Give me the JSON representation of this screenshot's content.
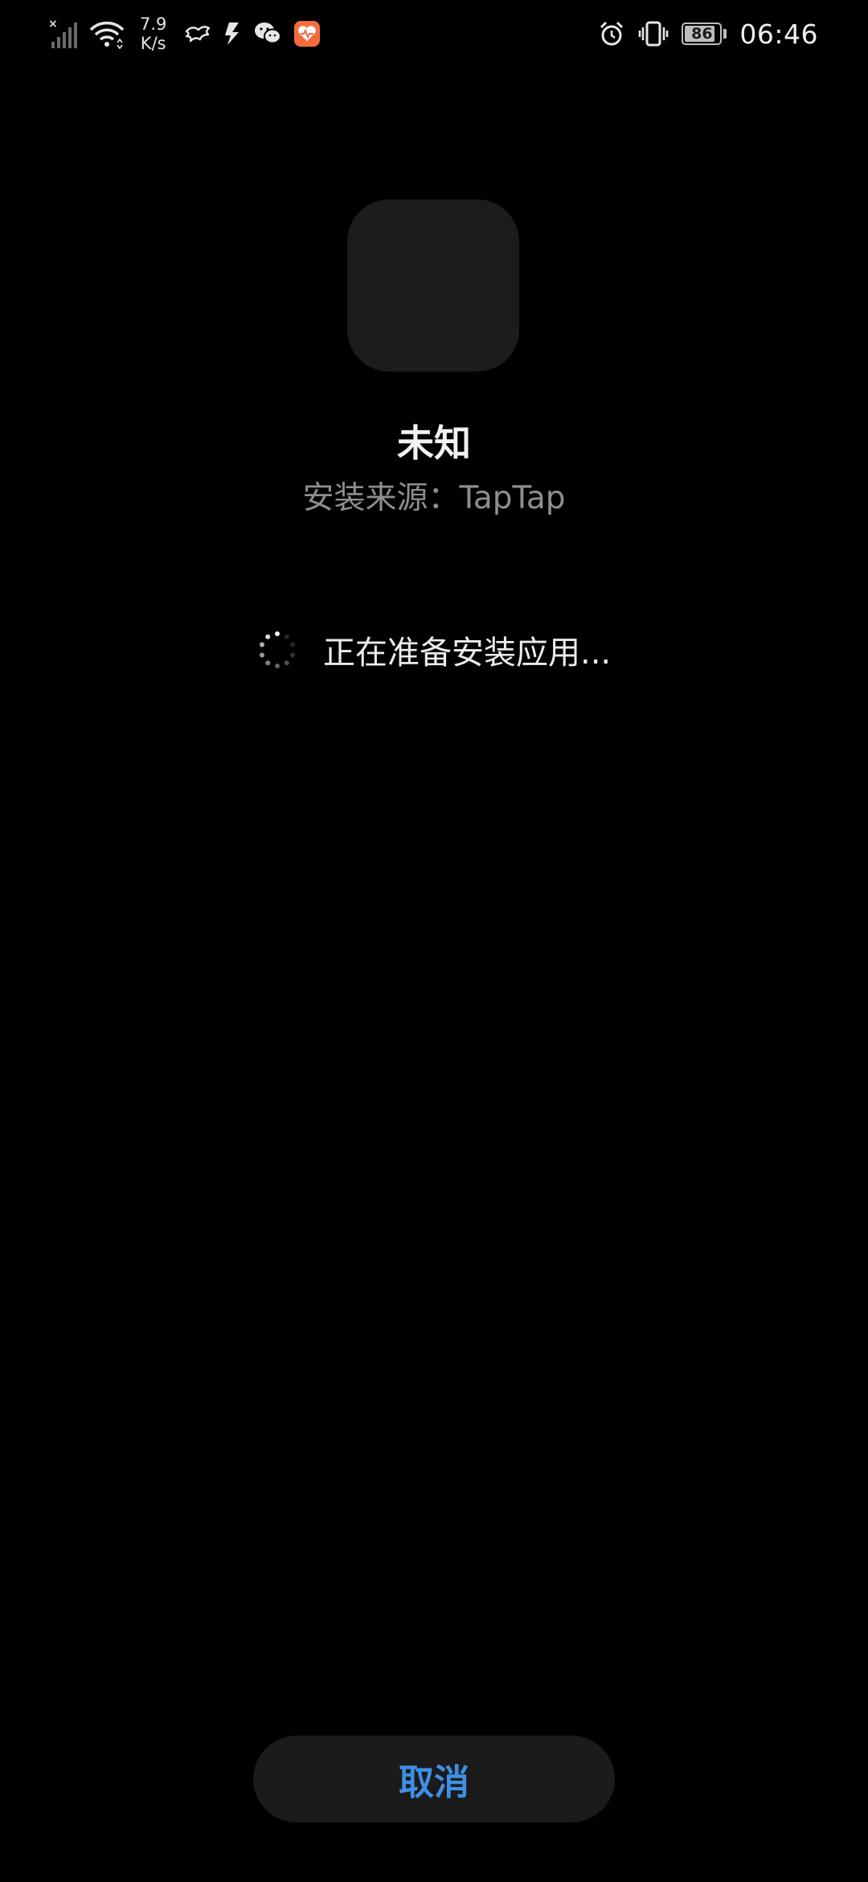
{
  "status_bar": {
    "net_speed_value": "7.9",
    "net_speed_unit": "K/s",
    "battery_level": "86",
    "battery_fraction": 0.86,
    "time": "06:46",
    "left_icons": [
      "signal-off-icon",
      "wifi-icon",
      "dragon-app-icon",
      "lightning-app-icon",
      "wechat-icon",
      "health-app-icon"
    ],
    "right_icons": [
      "alarm-icon",
      "vibrate-icon",
      "battery-icon"
    ],
    "health_icon_color": "#f46b3c"
  },
  "app": {
    "name": "未知",
    "install_source": "安装来源：TapTap"
  },
  "progress": {
    "text": "正在准备安装应用..."
  },
  "actions": {
    "cancel_label": "取消"
  },
  "colors": {
    "background": "#000000",
    "accent": "#3f8fe5",
    "button_background": "#1b1b1b",
    "icon_placeholder": "#1c1c1c"
  }
}
